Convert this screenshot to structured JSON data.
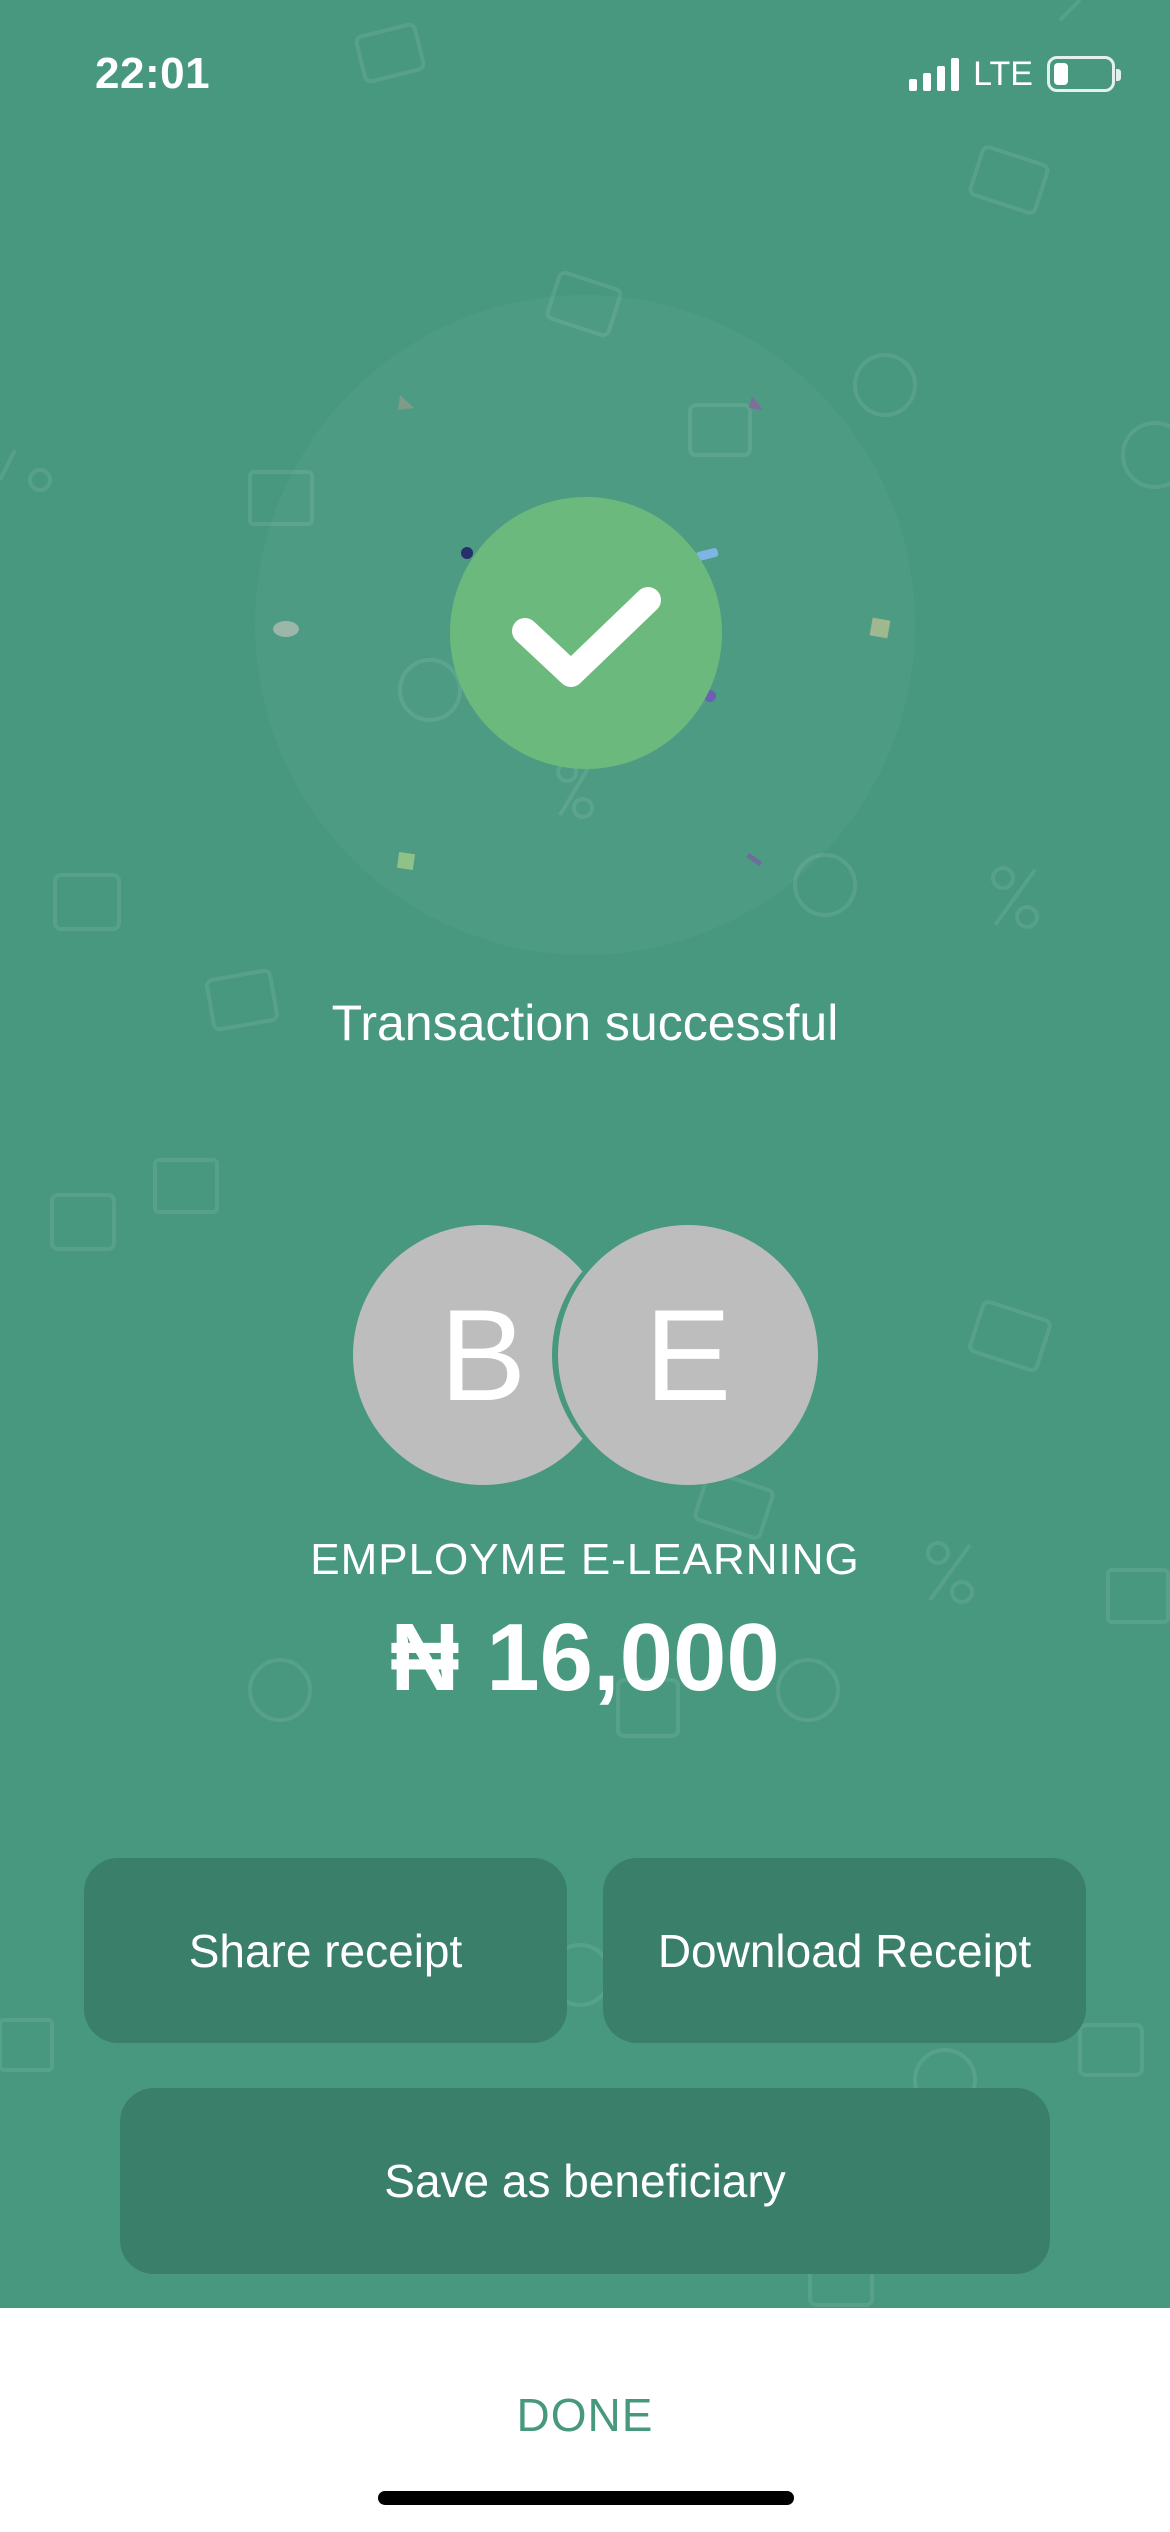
{
  "status_bar": {
    "time": "22:01",
    "network": "LTE",
    "signal_icon": "cellular-signal-icon",
    "battery_icon": "battery-icon",
    "battery_level": 0.25
  },
  "success": {
    "icon": "checkmark-icon",
    "message": "Transaction successful"
  },
  "recipient": {
    "initials": [
      "B",
      "E"
    ],
    "name": "EMPLOYME E-LEARNING",
    "amount": "₦ 16,000"
  },
  "actions": {
    "share_label": "Share receipt",
    "download_label": "Download Receipt",
    "save_label": "Save as beneficiary",
    "done_label": "DONE"
  },
  "colors": {
    "background": "#47987f",
    "button": "#3a7f6a",
    "check_circle": "#6cb97e",
    "avatar": "#bdbdbd",
    "done_text": "#47987f"
  }
}
